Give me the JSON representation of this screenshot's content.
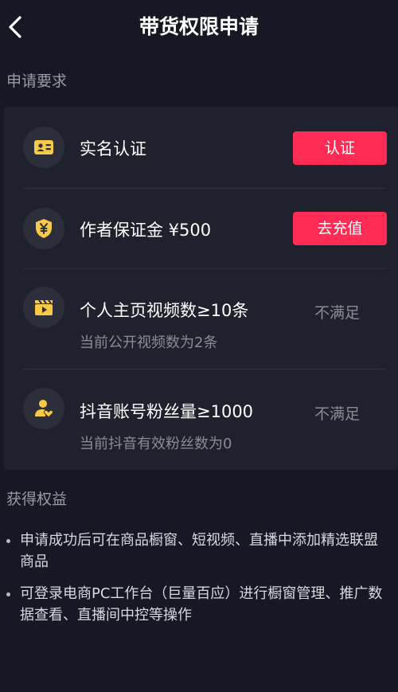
{
  "header": {
    "title": "带货权限申请",
    "back_icon": "chevron-left-icon"
  },
  "requirements": {
    "label": "申请要求",
    "items": [
      {
        "icon": "id-card-icon",
        "title": "实名认证",
        "action": "认证"
      },
      {
        "icon": "shield-yen-icon",
        "title": "作者保证金 ¥500",
        "action": "去充值"
      },
      {
        "icon": "clapperboard-icon",
        "title": "个人主页视频数≥10条",
        "subtitle": "当前公开视频数为2条",
        "status": "不满足"
      },
      {
        "icon": "fans-icon",
        "title": "抖音账号粉丝量≥1000",
        "subtitle": "当前抖音有效粉丝数为0",
        "status": "不满足"
      }
    ]
  },
  "benefits": {
    "label": "获得权益",
    "items": [
      "申请成功后可在商品橱窗、短视频、直播中添加精选联盟商品",
      "可登录电商PC工作台（巨量百应）进行橱窗管理、推广数据查看、直播间中控等操作"
    ]
  },
  "colors": {
    "background": "#161823",
    "card": "#1f212c",
    "accent": "#fe2c55",
    "icon": "#f7c948"
  }
}
